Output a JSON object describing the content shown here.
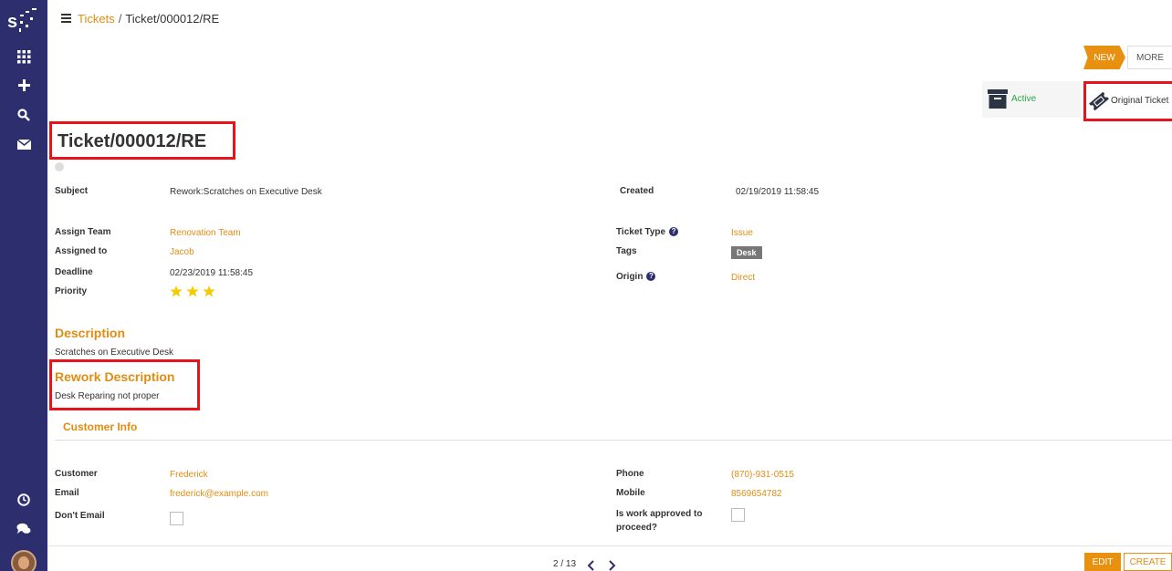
{
  "breadcrumb": {
    "parent": "Tickets",
    "current": "Ticket/000012/RE"
  },
  "statusbar": {
    "current_stage": "NEW",
    "more": "MORE"
  },
  "smart_buttons": {
    "active_label": "Active",
    "original_ticket_label": "Original Ticket"
  },
  "ticket": {
    "title": "Ticket/000012/RE",
    "subject": {
      "label": "Subject",
      "value": "Rework:Scratches on Executive Desk"
    },
    "created": {
      "label": "Created",
      "value": "02/19/2019 11:58:45"
    },
    "assign_team": {
      "label": "Assign Team",
      "value": "Renovation Team"
    },
    "assigned_to": {
      "label": "Assigned to",
      "value": "Jacob"
    },
    "deadline": {
      "label": "Deadline",
      "value": "02/23/2019 11:58:45"
    },
    "priority": {
      "label": "Priority",
      "stars": 3
    },
    "ticket_type": {
      "label": "Ticket Type",
      "value": "Issue"
    },
    "tags": {
      "label": "Tags",
      "value": "Desk"
    },
    "origin": {
      "label": "Origin",
      "value": "Direct"
    }
  },
  "description": {
    "heading": "Description",
    "text": "Scratches on Executive Desk"
  },
  "rework": {
    "heading": "Rework Description",
    "text": "Desk Reparing not proper"
  },
  "customer_info": {
    "heading": "Customer Info",
    "customer": {
      "label": "Customer",
      "value": "Frederick"
    },
    "email": {
      "label": "Email",
      "value": "frederick@example.com"
    },
    "dont_email": {
      "label": "Don't Email",
      "checked": false
    },
    "phone": {
      "label": "Phone",
      "value": "(870)-931-0515"
    },
    "mobile": {
      "label": "Mobile",
      "value": "8569654782"
    },
    "work_approved": {
      "label_line1": "Is work approved to",
      "label_line2": "proceed?",
      "checked": false
    }
  },
  "pager": {
    "text": "2 / 13"
  },
  "actions": {
    "edit": "EDIT",
    "create": "CREATE"
  },
  "colors": {
    "sidebar": "#2c2e6e",
    "accent": "#e08d12",
    "highlight": "#e8131b",
    "active": "#28a745"
  },
  "icons": [
    "app-logo-icon",
    "apps-grid-icon",
    "plus-icon",
    "search-icon",
    "mail-icon",
    "clock-icon",
    "chat-icon",
    "menu-icon",
    "archive-box-icon",
    "ticket-icon",
    "star-icon",
    "help-icon",
    "chevron-left-icon",
    "chevron-right-icon"
  ]
}
